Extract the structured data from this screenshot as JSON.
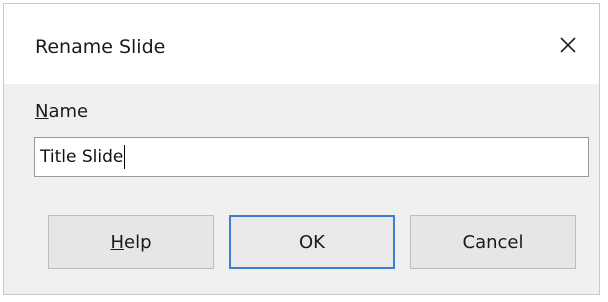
{
  "dialog": {
    "title": "Rename Slide",
    "close_icon": "close-icon"
  },
  "name_field": {
    "label_mnemonic": "N",
    "label_rest": "ame",
    "value": "Title Slide"
  },
  "buttons": {
    "help_mnemonic": "H",
    "help_rest": "elp",
    "ok": "OK",
    "cancel": "Cancel"
  },
  "colors": {
    "default_button_border": "#3c7fd0",
    "content_background": "#f0f0f0"
  }
}
